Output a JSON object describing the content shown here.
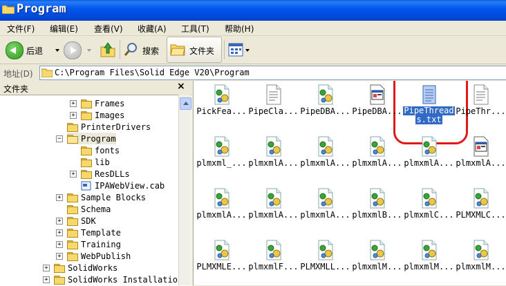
{
  "window": {
    "title": "Program"
  },
  "menu": [
    "文件(F)",
    "编辑(E)",
    "查看(V)",
    "收藏(A)",
    "工具(T)",
    "帮助(H)"
  ],
  "toolbar": {
    "back_label": "后退",
    "search_label": "搜索",
    "folders_label": "文件夹"
  },
  "address": {
    "label": "地址(D)",
    "path": "C:\\Program Files\\Solid Edge V20\\Program"
  },
  "folders_panel": {
    "title": "文件夹",
    "close": "×"
  },
  "tree": [
    {
      "label": "Frames",
      "expander": "+",
      "open": false
    },
    {
      "label": "Images",
      "expander": "+",
      "open": false
    },
    {
      "label": "PrinterDrivers",
      "expander": "",
      "open": false
    },
    {
      "label": "Program",
      "expander": "−",
      "open": true
    },
    {
      "label": "fonts",
      "expander": "",
      "open": false
    },
    {
      "label": "lib",
      "expander": "",
      "open": false
    },
    {
      "label": "ResDLLs",
      "expander": "+",
      "open": false
    },
    {
      "label": "IPAWebView.cab",
      "expander": "",
      "open": false
    },
    {
      "label": "Sample Blocks",
      "expander": "+",
      "open": false
    },
    {
      "label": "Schema",
      "expander": "",
      "open": false
    },
    {
      "label": "SDK",
      "expander": "+",
      "open": false
    },
    {
      "label": "Template",
      "expander": "+",
      "open": false
    },
    {
      "label": "Training",
      "expander": "+",
      "open": false
    },
    {
      "label": "WebPublish",
      "expander": "+",
      "open": false
    },
    {
      "label": "SolidWorks",
      "expander": "+",
      "open": false
    },
    {
      "label": "SolidWorks Installation",
      "expander": "+",
      "open": false
    }
  ],
  "files": [
    {
      "name": "PickFea...",
      "icon": "gear-file-icon"
    },
    {
      "name": "PipeCla...",
      "icon": "text-file-icon"
    },
    {
      "name": "PipeDBA...",
      "icon": "gear-file-icon"
    },
    {
      "name": "PipeDBA...",
      "icon": "window-file-icon"
    },
    {
      "name": "PipeThread",
      "name2": "s.txt",
      "icon": "notepad-file-icon",
      "selected": true
    },
    {
      "name": "PipeThr...",
      "icon": "text-file-icon"
    },
    {
      "name": "plmxml_...",
      "icon": "gear-file-icon"
    },
    {
      "name": "plmxmlA...",
      "icon": "gear-file-icon"
    },
    {
      "name": "plmxmlA...",
      "icon": "gear-file-icon"
    },
    {
      "name": "plmxmlA...",
      "icon": "gear-file-icon"
    },
    {
      "name": "plmxmlA...",
      "icon": "gear-file-icon"
    },
    {
      "name": "plmxmlA...",
      "icon": "window-file-icon"
    },
    {
      "name": "plmxmlA...",
      "icon": "gear-file-icon"
    },
    {
      "name": "plmxmlA...",
      "icon": "gear-file-icon"
    },
    {
      "name": "plmxmlA...",
      "icon": "gear-file-icon"
    },
    {
      "name": "plmxmlB...",
      "icon": "gear-file-icon"
    },
    {
      "name": "plmxmlC...",
      "icon": "gear-file-icon"
    },
    {
      "name": "PLMXMLC...",
      "icon": "gear-file-icon"
    },
    {
      "name": "PLMXMLE...",
      "icon": "gear-file-icon"
    },
    {
      "name": "plmxmlF...",
      "icon": "gear-file-icon"
    },
    {
      "name": "PLMXMLL...",
      "icon": "gear-file-icon"
    },
    {
      "name": "plmxmlM...",
      "icon": "gear-file-icon"
    },
    {
      "name": "plmxmlM...",
      "icon": "gear-file-icon"
    },
    {
      "name": "plmxmlM...",
      "icon": "gear-file-icon"
    }
  ],
  "colors": {
    "titlebar": "#0058ee",
    "selection": "#316ac5",
    "annotation_ring": "#e01818"
  }
}
